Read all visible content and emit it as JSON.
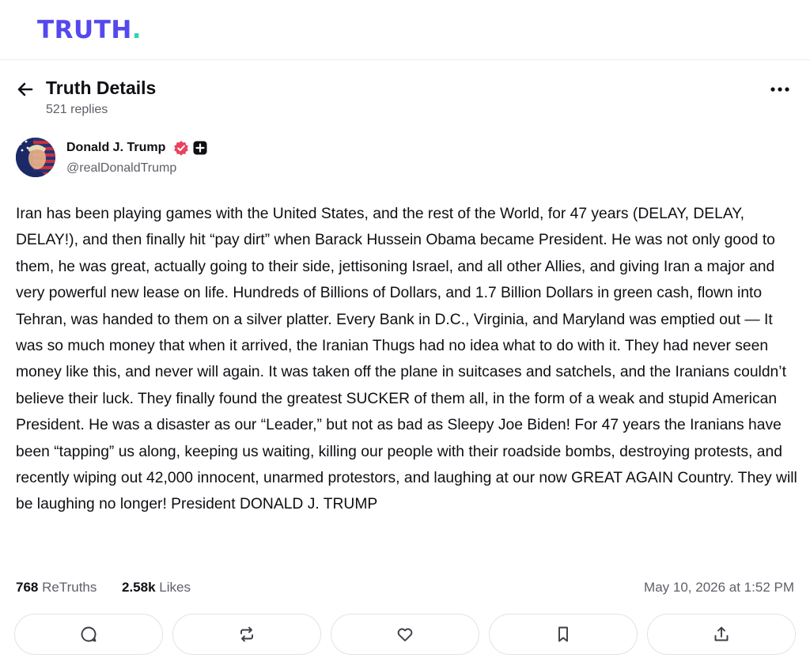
{
  "brand": {
    "logo_text": "TRUTH",
    "logo_dot": ".",
    "logo_color": "#5448ee",
    "dot_color": "#2bd6b0"
  },
  "header": {
    "back_icon": "arrow-left-icon",
    "title": "Truth Details",
    "reply_count": "521 replies",
    "more_icon": "more-horizontal-icon"
  },
  "post": {
    "author": {
      "name": "Donald J. Trump",
      "handle": "@realDonaldTrump",
      "verified_icon": "verified-badge-icon",
      "plus_icon": "plus-square-icon",
      "verified_color": "#e8425f"
    },
    "text": "Iran has been playing games with the United States, and the rest of the World, for 47 years (DELAY, DELAY, DELAY!), and then finally hit “pay dirt” when Barack Hussein Obama became President. He was not only good to them, he was great, actually going to their side, jettisoning Israel, and all other Allies, and giving Iran a major and very powerful new lease on life. Hundreds of Billions of Dollars, and 1.7 Billion Dollars in green cash, flown into Tehran, was handed to them on a silver platter. Every Bank in D.C., Virginia, and Maryland was emptied out — It was so much money that when it arrived, the Iranian Thugs had no idea what to do with it. They had never seen money like this, and never will again. It was taken off the plane in suitcases and satchels, and the Iranians couldn’t believe their luck. They finally found the greatest SUCKER of them all, in the form of a weak and stupid American President. He was a disaster as our “Leader,” but not as bad as Sleepy Joe Biden! For 47 years the Iranians have been “tapping” us along, keeping us waiting, killing our people with their roadside bombs, destroying protests, and recently wiping out 42,000 innocent, unarmed protestors, and laughing at our now GREAT AGAIN Country. They will be laughing no longer! President DONALD J. TRUMP",
    "retruths_count": "768",
    "retruths_label": "ReTruths",
    "likes_count": "2.58k",
    "likes_label": "Likes",
    "timestamp": "May 10, 2026 at 1:52 PM"
  },
  "actions": [
    {
      "name": "reply-button",
      "icon": "comment-icon"
    },
    {
      "name": "retruth-button",
      "icon": "repost-icon"
    },
    {
      "name": "like-button",
      "icon": "heart-icon"
    },
    {
      "name": "bookmark-button",
      "icon": "bookmark-icon"
    },
    {
      "name": "share-button",
      "icon": "share-icon"
    }
  ]
}
